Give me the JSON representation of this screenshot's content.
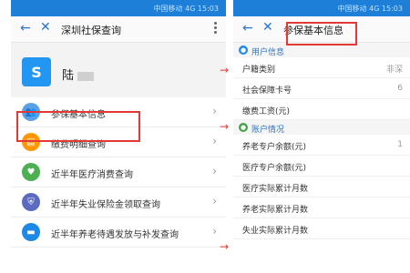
{
  "status": {
    "right_text": "中国移动 4G  15:03"
  },
  "left": {
    "title": "深圳社保查询",
    "profile": {
      "name": "陆",
      "logo_text": "S"
    },
    "items": [
      {
        "label": "参保基本信息",
        "icon": "people-icon",
        "color": "#5aa0e6"
      },
      {
        "label": "缴费明细查询",
        "icon": "document-icon",
        "color": "#ff9800"
      },
      {
        "label": "近半年医疗消费查询",
        "icon": "heart-icon",
        "color": "#4caf50"
      },
      {
        "label": "近半年失业保险金领取查询",
        "icon": "shield-icon",
        "color": "#5c6bc0"
      },
      {
        "label": "近半年养老待遇发放与补发查询",
        "icon": "bus-icon",
        "color": "#1e88e5"
      }
    ]
  },
  "right": {
    "title": "参保基本信息",
    "section1": "用户信息",
    "rows1": [
      {
        "label": "户籍类别",
        "value": "非深"
      },
      {
        "label": "社会保障卡号",
        "value": "6"
      },
      {
        "label": "缴费工资(元)",
        "value": ""
      }
    ],
    "section2": "账户情况",
    "rows2": [
      {
        "label": "养老专户余额(元)",
        "value": "1"
      },
      {
        "label": "医疗专户余额(元)",
        "value": ""
      },
      {
        "label": "医疗实际累计月数",
        "value": ""
      },
      {
        "label": "养老实际累计月数",
        "value": ""
      },
      {
        "label": "失业实际累计月数",
        "value": ""
      }
    ]
  }
}
